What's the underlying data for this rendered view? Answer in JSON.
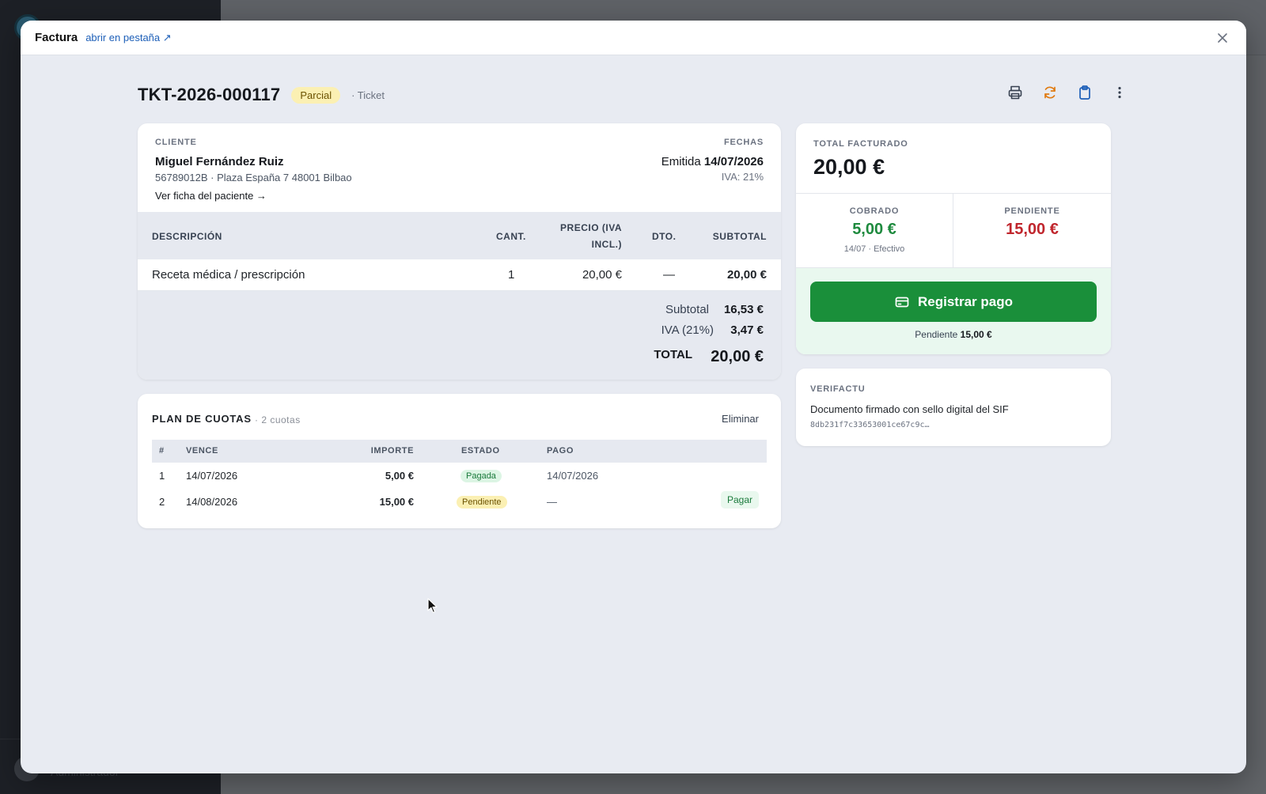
{
  "background": {
    "user": "Administrador"
  },
  "modal": {
    "title": "Factura",
    "open_in_tab": "abrir en pestaña ↗",
    "close_icon": "close-icon"
  },
  "document": {
    "number": "TKT-2026-000117",
    "status": "Parcial",
    "type": "· Ticket",
    "toolbar": [
      "printer-icon",
      "refresh-icon",
      "clipboard-icon",
      "more-vertical-icon"
    ]
  },
  "client": {
    "label": "CLIENTE",
    "name": "Miguel Fernández Ruiz",
    "address": "56789012B · Plaza España 7 48001 Bilbao",
    "link": "Ver ficha del paciente →"
  },
  "dates": {
    "label": "FECHAS",
    "issued_label": "Emitida",
    "issued_date": "14/07/2026",
    "iva": "IVA: 21%"
  },
  "lines": {
    "headers": {
      "description": "DESCRIPCIÓN",
      "qty": "CANT.",
      "price_1": "PRECIO (IVA",
      "price_2": "INCL.)",
      "discount": "DTO.",
      "subtotal": "SUBTOTAL"
    },
    "items": [
      {
        "description": "Receta médica / prescripción",
        "qty": "1",
        "price": "20,00 €",
        "discount": "—",
        "subtotal": "20,00 €"
      }
    ]
  },
  "totals": {
    "subtotal_label": "Subtotal",
    "subtotal": "16,53 €",
    "iva_label": "IVA (21%)",
    "iva": "3,47 €",
    "total_label": "TOTAL",
    "total": "20,00 €"
  },
  "plan": {
    "title": "PLAN DE CUOTAS",
    "count": "· 2 cuotas",
    "delete": "Eliminar",
    "headers": {
      "num": "#",
      "due": "VENCE",
      "amount": "IMPORTE",
      "status": "ESTADO",
      "payment": "PAGO"
    },
    "rows": [
      {
        "num": "1",
        "due": "14/07/2026",
        "amount": "5,00 €",
        "status": "Pagada",
        "payment": "14/07/2026"
      },
      {
        "num": "2",
        "due": "14/08/2026",
        "amount": "15,00 €",
        "status": "Pendiente",
        "payment": "—",
        "action": "Pagar"
      }
    ]
  },
  "summary": {
    "total_label": "TOTAL FACTURADO",
    "total": "20,00 €",
    "collected_label": "COBRADO",
    "collected": "5,00 €",
    "collected_note": "14/07 · Efectivo",
    "pending_label": "PENDIENTE",
    "pending": "15,00 €",
    "register_button": "Registrar pago",
    "pending_note_label": "Pendiente",
    "pending_note_value": "15,00 €"
  },
  "verifactu": {
    "label": "VERIFACTU",
    "text": "Documento firmado con sello digital del SIF",
    "hash": "8db231f7c33653001ce67c9c…"
  },
  "colors": {
    "accent_green": "#1a8f3a",
    "collected_green": "#1e8a3e",
    "pending_red": "#c0262d",
    "link_blue": "#1d5fb8",
    "badge_yellow": "#fbf0b3"
  }
}
